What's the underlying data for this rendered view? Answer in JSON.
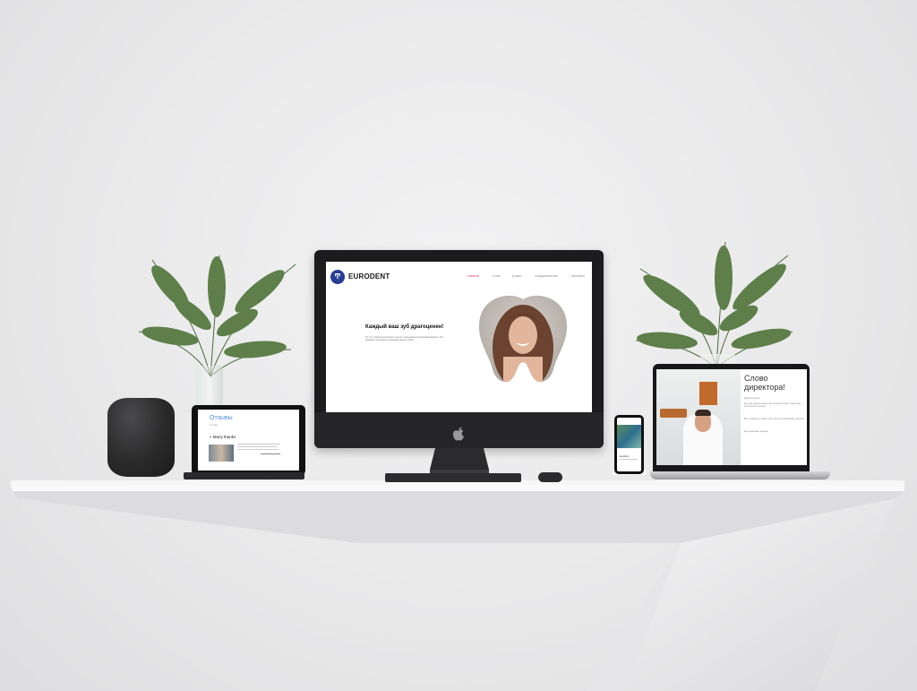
{
  "imac_site": {
    "brand": "EURODENT",
    "logo_glyph": "Ͳ",
    "nav": [
      "главная",
      "о нас",
      "услуги",
      "сотрудничество",
      "контакты"
    ],
    "hero_title": "Каждый ваш зуб драгоценен!",
    "hero_subtitle": "15 лет стоматологического опыта с передовыми клиниками Европы. Мы бережно относимся к здоровью ваших зубов."
  },
  "ipad_site": {
    "section_title": "Отзывы",
    "section_caption": "Отзывы",
    "quote": "« Many thanks"
  },
  "laptop_site": {
    "title": "Слово директора!",
    "paragraphs": [
      "Дорогие друзья!",
      "Мы рады приветствовать вас в нашей клинике. Наша цель — качественное лечение.",
      "Все специалисты имеют опыт работы в европейских клиниках.",
      "Мы ценим ваше доверие."
    ]
  },
  "phone_site": {
    "caption": "EuroDent"
  },
  "colors": {
    "accent": "#273e94",
    "nav_active": "#d04a5a",
    "ipad_title": "#4a8ed8"
  },
  "icons": [
    "apple-logo-icon",
    "tooth-logo-icon"
  ]
}
